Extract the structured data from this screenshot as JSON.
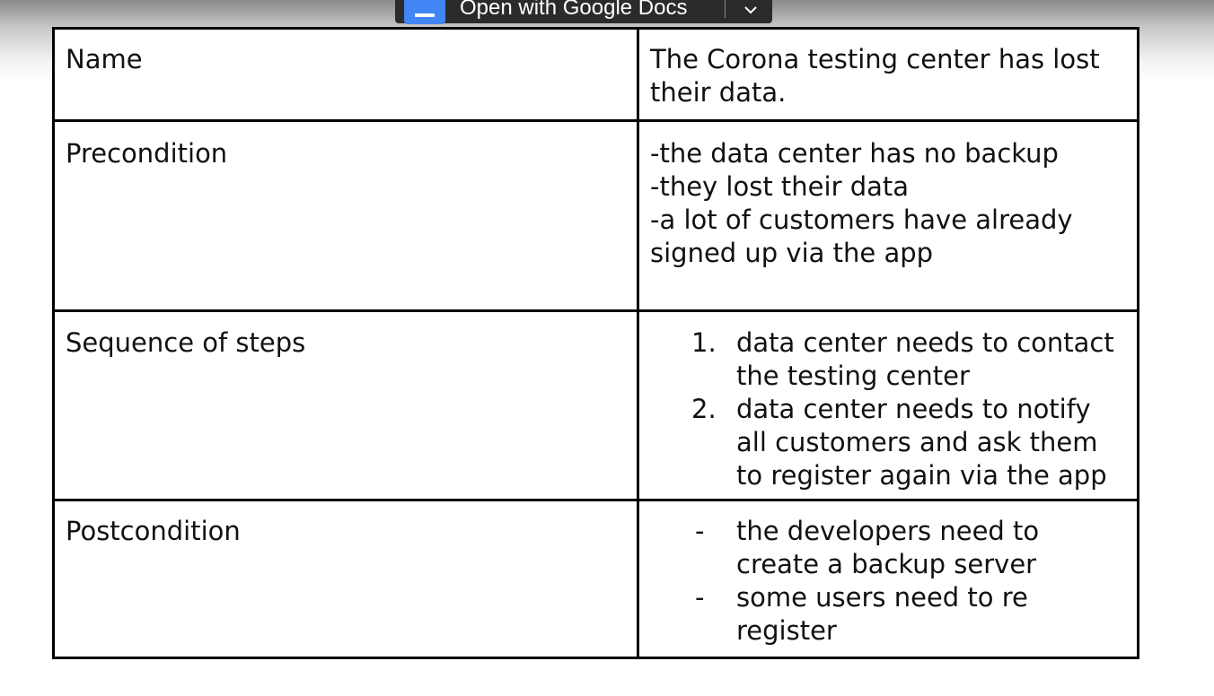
{
  "toolbar": {
    "open_with_label": "Open with Google Docs",
    "docs_icon": "google-docs-icon",
    "dropdown_icon": "chevron-down-icon"
  },
  "table": {
    "name": {
      "label": "Name",
      "value": "The Corona testing center has lost their data."
    },
    "precondition": {
      "label": "Precondition",
      "lines": [
        "-the data center has no backup",
        "-they lost their data",
        "-a lot of customers have already",
        "signed up via the app"
      ]
    },
    "sequence": {
      "label": "Sequence of steps",
      "steps": [
        {
          "marker": "1.",
          "text": "data center needs to contact the testing center"
        },
        {
          "marker": "2.",
          "text": "data center needs to notify all customers and ask them to register again via the app"
        }
      ]
    },
    "postcondition": {
      "label": "Postcondition",
      "items": [
        {
          "marker": "-",
          "text": "the developers need to create a backup server"
        },
        {
          "marker": "-",
          "text": "some users need to re register"
        }
      ]
    }
  },
  "colors": {
    "border": "#000000",
    "toolbar_bg": "#2b2b2b",
    "docs_blue": "#4285f4"
  }
}
